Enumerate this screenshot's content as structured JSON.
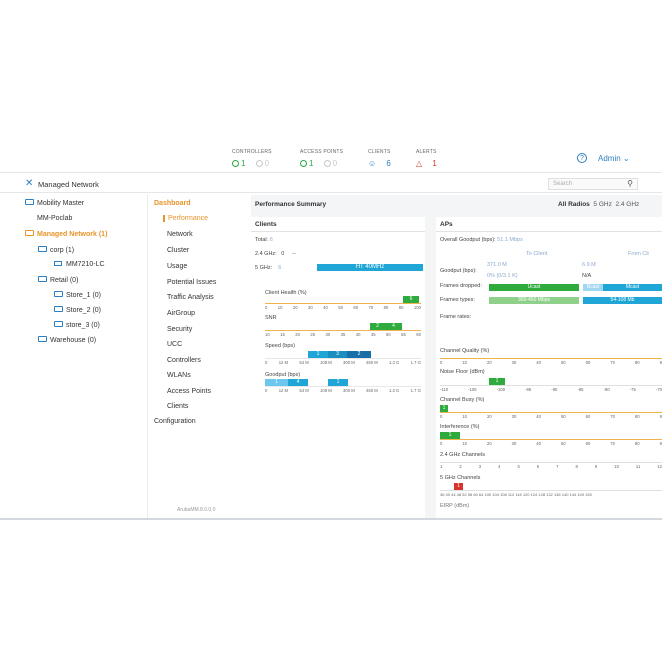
{
  "header": {
    "controllers": {
      "label": "CONTROLLERS",
      "ok": "1",
      "down": "0"
    },
    "access_points": {
      "label": "ACCESS POINTS",
      "ok": "1",
      "down": "0"
    },
    "clients": {
      "label": "CLIENTS",
      "count": "6"
    },
    "alerts": {
      "label": "ALERTS",
      "count": "1"
    },
    "help_icon": "?",
    "user_menu": "Admin ⌄"
  },
  "navbar": {
    "title": "Managed Network",
    "search_placeholder": "Search"
  },
  "tree": {
    "items": [
      {
        "label": "Mobility Master",
        "icon": "folder-icon"
      },
      {
        "label": "MM-Poclab",
        "icon": "none"
      },
      {
        "label": "Managed Network (1)",
        "icon": "folder-icon",
        "selected": true
      },
      {
        "label": "corp (1)",
        "icon": "folder-icon"
      },
      {
        "label": "MM7210-LC",
        "icon": "device-icon"
      },
      {
        "label": "Retail (0)",
        "icon": "folder-icon"
      },
      {
        "label": "Store_1 (0)",
        "icon": "folder-icon"
      },
      {
        "label": "Store_2 (0)",
        "icon": "folder-icon"
      },
      {
        "label": "store_3 (0)",
        "icon": "folder-icon"
      },
      {
        "label": "Warehouse (0)",
        "icon": "folder-icon"
      }
    ]
  },
  "menu": {
    "dashboard": "Dashboard",
    "items": [
      "Performance",
      "Network",
      "Cluster",
      "Usage",
      "Potential Issues",
      "Traffic Analysis",
      "AirGroup",
      "Security",
      "UCC",
      "Controllers",
      "WLANs",
      "Access Points",
      "Clients"
    ],
    "configuration": "Configuration",
    "version": "ArubaMM.8.0.0.0"
  },
  "content": {
    "title": "Performance Summary",
    "tabs": [
      "All Radios",
      "5 GHz",
      "2.4 GHz"
    ],
    "clients_panel": {
      "title": "Clients",
      "total_label": "Total:",
      "total_value": "6",
      "ghz24_label": "2.4 GHz:",
      "ghz24_value": "0",
      "ghz24_dash": "--",
      "ghz5_label": "5 GHz:",
      "ghz5_value": "6",
      "ghz5_bar": "HT 40MHz",
      "health_label": "Client Health (%)",
      "health_bar": "6",
      "health_ticks": [
        "0",
        "10",
        "20",
        "30",
        "40",
        "50",
        "60",
        "70",
        "80",
        "90",
        "100"
      ],
      "snr_label": "SNR",
      "snr_bars": [
        "2",
        "4"
      ],
      "snr_ticks": [
        "10",
        "15",
        "20",
        "25",
        "30",
        "35",
        "40",
        "45",
        "50",
        "55",
        "60"
      ],
      "speed_label": "Speed (bps)",
      "speed_bars": [
        "1",
        "3",
        "2"
      ],
      "speed_ticks": [
        "0",
        "12 M",
        "54 M",
        "108 M",
        "300 M",
        "450 M",
        "1.3 G",
        "1.7 G"
      ],
      "goodput_label": "Goodput (bps)",
      "goodput_bars": [
        "1",
        "4",
        "1"
      ],
      "goodput_ticks": [
        "0",
        "12 M",
        "54 M",
        "108 M",
        "300 M",
        "450 M",
        "1.3 G",
        "1.7 G"
      ]
    },
    "aps_panel": {
      "title": "APs",
      "overall_label": "Overall Goodput (bps):",
      "overall_value": "51.1 Mbps",
      "to_client": "To Client",
      "from_client": "From Cli",
      "goodput_label": "Goodput (bps):",
      "goodput_to": "371.0 M",
      "goodput_to_pct": "0% (0/3.1 K)",
      "goodput_from": "6.9 M",
      "goodput_from_pct": "N/A",
      "frames_dropped_label": "Frames dropped:",
      "frames_types_label": "Frames types:",
      "frame_rates_label": "Frame rates:",
      "ucast": "Ucast",
      "bcast": "Bcast",
      "mcast": "Mcast",
      "rate_to": "300-450 Mbps",
      "rate_from": "54-108 Mb",
      "channel_quality": "Channel Quality (%)",
      "cq_ticks": [
        "0",
        "10",
        "20",
        "30",
        "40",
        "50",
        "60",
        "70",
        "80",
        "9"
      ],
      "noise_floor": "Noise Floor (dBm)",
      "nf_bar": "1",
      "nf_ticks": [
        "-110",
        "-105",
        "-100",
        "-95",
        "-90",
        "-85",
        "-80",
        "-75",
        "-70"
      ],
      "channel_busy": "Channel Busy (%)",
      "cb_bar": "1",
      "cb_ticks": [
        "0",
        "10",
        "20",
        "30",
        "40",
        "50",
        "60",
        "70",
        "80",
        "9"
      ],
      "interference": "Interference (%)",
      "if_bar": "1",
      "if_ticks": [
        "0",
        "10",
        "20",
        "30",
        "40",
        "50",
        "60",
        "70",
        "80",
        "9"
      ],
      "ch24": "2.4 GHz Channels",
      "ch24_ticks": [
        "1",
        "2",
        "3",
        "4",
        "5",
        "6",
        "7",
        "8",
        "9",
        "10",
        "11",
        "12"
      ],
      "ch5": "5 GHz Channels",
      "ch5_bar": "1",
      "ch5_ticks": "36 40 44 48 52 56 60 64 100 104 108 112 116 120 124 128 132 136 140 144 149 153",
      "eirp": "EIRP (dBm)"
    }
  },
  "colors": {
    "accent": "#e8942a",
    "blue": "#2d7fc1",
    "green": "#2eab3c",
    "cyan": "#1fa6d6",
    "light_green": "#8fd18b",
    "light_blue": "#6cc6ee"
  }
}
